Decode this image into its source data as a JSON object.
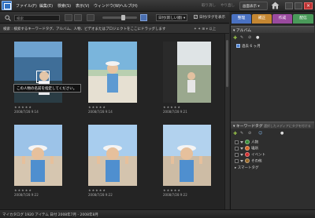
{
  "menu": {
    "items": [
      "ファイル(F)",
      "編集(E)",
      "検索(S)",
      "表示(V)",
      "ウィンドウ(W)",
      "ヘルプ(H)"
    ],
    "undo": "取り消し",
    "redo": "やり直し",
    "display": "画面表示"
  },
  "toolbar": {
    "search_placeholder": "検索",
    "sort": "日付(新しい順)",
    "show_details": "日付/タグを表示"
  },
  "hint": {
    "text": "検索 : 検索するキーワードタグ、アルバム、人物、ビデオまたはプロジェクトをここにドラッグします",
    "controls": "以上"
  },
  "grid": {
    "photos": [
      {
        "date": "2008/7/28 9:14",
        "stars": "★★★★★",
        "sky": "#7db0d8",
        "ground": "#3c4a4a"
      },
      {
        "date": "2008/7/28 9:14",
        "stars": "★★★★★",
        "sky": "#8cc4e6",
        "ground": "#d9d4c4"
      },
      {
        "date": "2008/7/28 9:21",
        "stars": "★★★★★",
        "sky": "#c9d4da",
        "ground": "#8a9a84"
      },
      {
        "date": "2008/7/28 9:22",
        "stars": "★★★★★",
        "sky": "#9cc3e8",
        "ground": "#d6c6b0"
      },
      {
        "date": "2008/7/28 9:22",
        "stars": "★★★★★",
        "sky": "#a8cdee",
        "ground": "#d4c4ae"
      },
      {
        "date": "2008/7/28 9:22",
        "stars": "★★★★★",
        "sky": "#b2d2ee",
        "ground": "#cdbca5"
      }
    ],
    "tooltip": "この人物の名前を指定してください。"
  },
  "panel": {
    "tabs": [
      "整理",
      "補正",
      "作成",
      "配信"
    ],
    "album_header": "▾ アルバム",
    "album_item": "過去 6 ヶ月",
    "keyword_header": "▾ キーワードタグ",
    "keyword_hint": "選択したメディアにタグを付ける",
    "keywords": [
      {
        "label": "人物",
        "color": "#3a8f3a"
      },
      {
        "label": "場所",
        "color": "#d86a2a"
      },
      {
        "label": "イベント",
        "color": "#d43030"
      },
      {
        "label": "その他",
        "color": "#9a6a2a"
      }
    ],
    "smart_tag": "▸ スマートタグ"
  },
  "status": {
    "text": "マイカタログ   1920 アイテム  日付 2008年7月 - 2008年8月"
  }
}
